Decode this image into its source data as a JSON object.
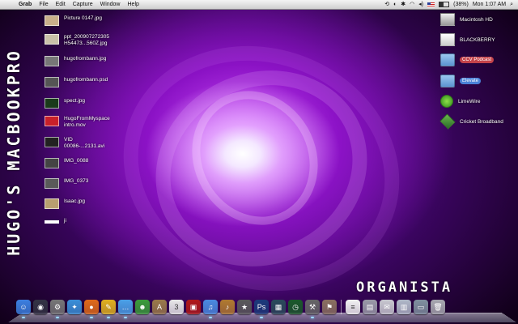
{
  "menubar": {
    "apple": "",
    "app": "Grab",
    "items": [
      "File",
      "Edit",
      "Capture",
      "Window",
      "Help"
    ],
    "battery": "(38%)",
    "clock": "Mon 1:07 AM"
  },
  "desktop_title": "HUGO'S MACBOOKPRO",
  "organista": "ORGANISTA",
  "left_files": [
    {
      "label": "Picture 0147.jpg",
      "color": "#c9b08a"
    },
    {
      "label": "ppt_200907272305\nH54473...560Z.jpg",
      "color": "#c9c1a8"
    },
    {
      "label": "hugofrombann.jpg",
      "color": "#777777"
    },
    {
      "label": "hugofrombann.psd",
      "color": "#555555"
    },
    {
      "label": "spect.jpg",
      "color": "#1a3a1a"
    },
    {
      "label": "HugoFromMyspace\nintro.mov",
      "color": "#c8202a"
    },
    {
      "label": "VID\n00086-...2131.avi",
      "color": "#222222"
    },
    {
      "label": "IMG_0088",
      "color": "#444444"
    },
    {
      "label": "IMG_0373",
      "color": "#5a5a5a"
    },
    {
      "label": "Isaac.jpg",
      "color": "#b8a070"
    },
    {
      "label": "ji",
      "color": "#ffffff"
    }
  ],
  "right_items": [
    {
      "label": "Macintosh HD",
      "style": "plain",
      "icon": "hard-drive-icon"
    },
    {
      "label": "BLACKBERRY",
      "style": "plain",
      "icon": "drive-icon"
    },
    {
      "label": "CCV Podcast",
      "style": "red",
      "icon": "folder-icon"
    },
    {
      "label": "Elevate",
      "style": "blue",
      "icon": "folder-icon"
    },
    {
      "label": "LimeWire",
      "style": "plain",
      "icon": "limewire-icon"
    },
    {
      "label": "Cricket Broadband",
      "style": "plain",
      "icon": "cricket-icon"
    }
  ],
  "dock": [
    {
      "name": "finder",
      "color": "#3c7fe0",
      "glyph": "☺"
    },
    {
      "name": "dashboard",
      "color": "#333344",
      "glyph": "◉"
    },
    {
      "name": "system-preferences",
      "color": "#777777",
      "glyph": "⚙"
    },
    {
      "name": "safari",
      "color": "#3a8fd8",
      "glyph": "✦"
    },
    {
      "name": "firefox",
      "color": "#e06a1a",
      "glyph": "●"
    },
    {
      "name": "adium",
      "color": "#e0b020",
      "glyph": "✎"
    },
    {
      "name": "ichat",
      "color": "#4aa0e8",
      "glyph": "…"
    },
    {
      "name": "address-book",
      "color": "#3b9c3b",
      "glyph": "☻"
    },
    {
      "name": "dictionary",
      "color": "#9a7a4a",
      "glyph": "A"
    },
    {
      "name": "ical",
      "color": "#e8e8e8",
      "glyph": "3"
    },
    {
      "name": "photo-booth",
      "color": "#b01818",
      "glyph": "▣"
    },
    {
      "name": "itunes",
      "color": "#4a8ae0",
      "glyph": "♫"
    },
    {
      "name": "garageband",
      "color": "#b07a30",
      "glyph": "♪"
    },
    {
      "name": "imovie",
      "color": "#5a5a5a",
      "glyph": "★"
    },
    {
      "name": "photoshop",
      "color": "#1c3a7a",
      "glyph": "Ps"
    },
    {
      "name": "expose",
      "color": "#2a4a5a",
      "glyph": "▦"
    },
    {
      "name": "time-machine",
      "color": "#1a5a2a",
      "glyph": "◷"
    },
    {
      "name": "network-utility",
      "color": "#666666",
      "glyph": "⚒"
    },
    {
      "name": "utility-app",
      "color": "#8a7060",
      "glyph": "⚑"
    },
    {
      "name": "document",
      "color": "#f2f2f2",
      "glyph": "≡"
    },
    {
      "name": "scanner",
      "color": "#9a9aa8",
      "glyph": "▤"
    },
    {
      "name": "mail-stack",
      "color": "#c8c8d0",
      "glyph": "✉"
    },
    {
      "name": "downloads-stack",
      "color": "#b0b8c8",
      "glyph": "▥"
    },
    {
      "name": "monitor",
      "color": "#8090a0",
      "glyph": "▭"
    },
    {
      "name": "trash",
      "color": "#a8a8b0",
      "glyph": "🗑"
    }
  ]
}
